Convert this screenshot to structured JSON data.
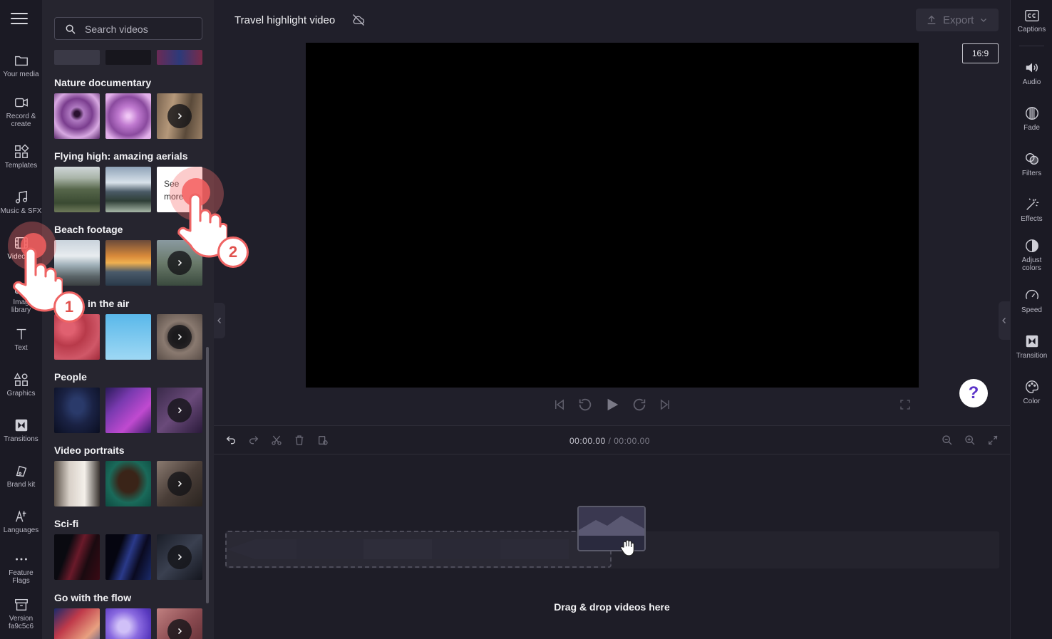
{
  "search": {
    "placeholder": "Search videos"
  },
  "left_rail": [
    {
      "label": "Your media"
    },
    {
      "label": "Record &",
      "label2": "create"
    },
    {
      "label": "Templates"
    },
    {
      "label": "Music & SFX"
    },
    {
      "label": "Video lib"
    },
    {
      "label": "Imag",
      "label2": "library"
    },
    {
      "label": "Text"
    },
    {
      "label": "Graphics"
    },
    {
      "label": "Transitions"
    },
    {
      "label": "Brand kit"
    },
    {
      "label": "Languages"
    },
    {
      "label": "Feature",
      "label2": "Flags"
    },
    {
      "label": "Version",
      "label2": "fa9c5c6"
    }
  ],
  "sections": [
    {
      "title": "Nature documentary"
    },
    {
      "title": "Flying high: amazing aerials",
      "see_more": "See",
      "see_more2": "more"
    },
    {
      "title": "Beach footage"
    },
    {
      "title": "in the air"
    },
    {
      "title": "People"
    },
    {
      "title": "Video portraits"
    },
    {
      "title": "Sci-fi"
    },
    {
      "title": "Go with the flow"
    }
  ],
  "topbar": {
    "project_title": "Travel highlight video",
    "export_label": "Export",
    "aspect_ratio": "16:9"
  },
  "timeline": {
    "current_time": "00:00.00",
    "separator": " / ",
    "total_time": "00:00.00",
    "drop_text": "Drag & drop videos here"
  },
  "right_rail": [
    {
      "label": "Captions"
    },
    {
      "label": "Audio"
    },
    {
      "label": "Fade"
    },
    {
      "label": "Filters"
    },
    {
      "label": "Effects"
    },
    {
      "label": "Adjust",
      "label2": "colors"
    },
    {
      "label": "Speed"
    },
    {
      "label": "Transition"
    },
    {
      "label": "Color"
    }
  ],
  "tutorial": {
    "step1": "1",
    "step2": "2"
  },
  "help": {
    "label": "?"
  },
  "colors": {
    "accent": "#5b33c9",
    "ripple": "#f05f5f",
    "bg": "#201f2a"
  }
}
